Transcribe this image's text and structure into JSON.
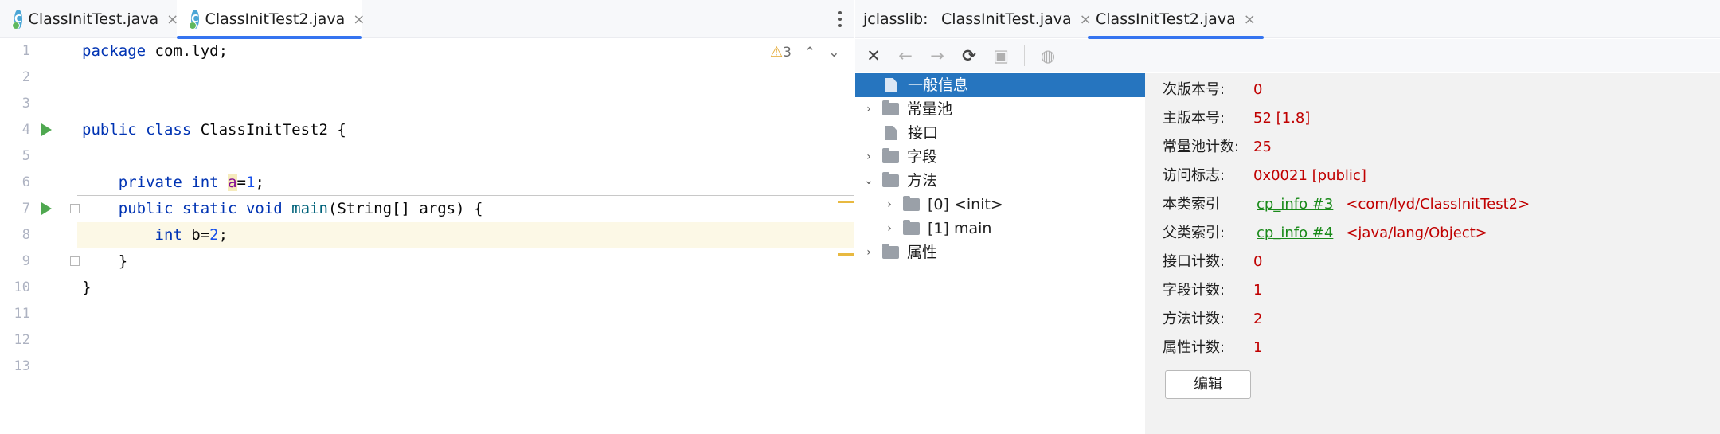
{
  "editor": {
    "tabs": [
      {
        "label": "ClassInitTest.java",
        "close": "×"
      },
      {
        "label": "ClassInitTest2.java",
        "close": "×"
      }
    ],
    "file_icon_letter": "C",
    "warnings": {
      "count": "3"
    },
    "line_numbers": [
      "1",
      "2",
      "3",
      "4",
      "5",
      "6",
      "7",
      "8",
      "9",
      "10",
      "11",
      "12",
      "13"
    ],
    "code": {
      "l1_kw": "package",
      "l1_rest": " com.lyd;",
      "l4_kw1": "public",
      "l4_kw2": "class",
      "l4_rest": " ClassInitTest2 {",
      "l6_indent": "    ",
      "l6_kw1": "private",
      "l6_kw2": "int",
      "l6_var": "a",
      "l6_eq": "=",
      "l6_num": "1",
      "l6_end": ";",
      "l7_indent": "    ",
      "l7_kw1": "public",
      "l7_kw2": "static",
      "l7_kw3": "void",
      "l7_fn": "main",
      "l7_rest": "(String[] args) {",
      "l8_indent": "        ",
      "l8_kw": "int",
      "l8_var": " b=",
      "l8_num": "2",
      "l8_end": ";",
      "l9": "    }",
      "l10": "}"
    }
  },
  "jclasslib": {
    "label": "jclasslib:",
    "tabs": [
      {
        "label": "ClassInitTest.java",
        "close": "×"
      },
      {
        "label": "ClassInitTest2.java",
        "close": "×"
      }
    ],
    "toolbar": {
      "close": "✕",
      "back": "←",
      "forward": "→",
      "refresh": "⟳",
      "save": "▣",
      "web": "◍"
    },
    "tree": [
      {
        "label": "一般信息"
      },
      {
        "label": "常量池"
      },
      {
        "label": "接口"
      },
      {
        "label": "字段"
      },
      {
        "label": "方法"
      },
      {
        "label": "[0] <init>"
      },
      {
        "label": "[1] main"
      },
      {
        "label": "属性"
      }
    ],
    "tree_arrows": {
      "collapsed": "›",
      "expanded": "⌄"
    },
    "details": [
      {
        "label": "次版本号:",
        "value": "0"
      },
      {
        "label": "主版本号:",
        "value": "52 [1.8]"
      },
      {
        "label": "常量池计数:",
        "value": "25"
      },
      {
        "label": "访问标志:",
        "value": "0x0021 [public]"
      },
      {
        "label": "本类索引",
        "link": "cp_info #3",
        "extra": "<com/lyd/ClassInitTest2>"
      },
      {
        "label": "父类索引:",
        "link": "cp_info #4",
        "extra": "<java/lang/Object>"
      },
      {
        "label": "接口计数:",
        "value": "0"
      },
      {
        "label": "字段计数:",
        "value": "1"
      },
      {
        "label": "方法计数:",
        "value": "2"
      },
      {
        "label": "属性计数:",
        "value": "1"
      }
    ],
    "edit_button": "编辑"
  }
}
